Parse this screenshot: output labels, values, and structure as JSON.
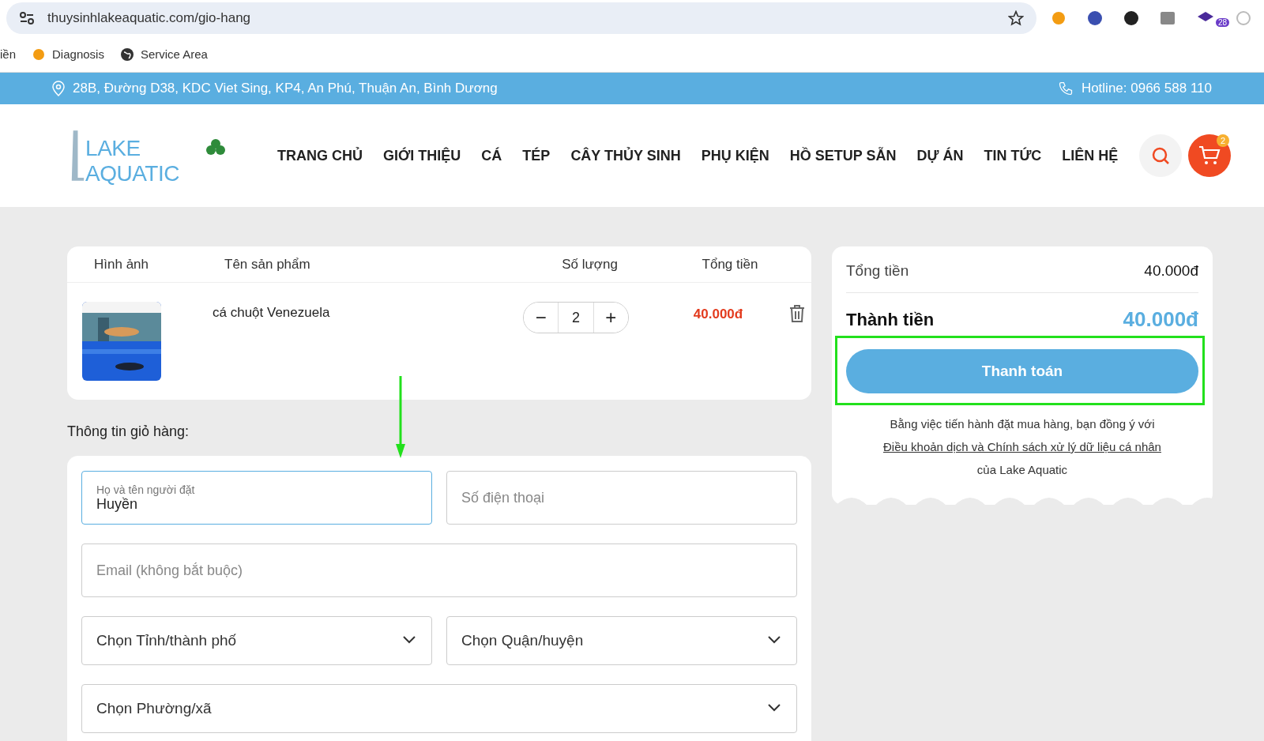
{
  "browser": {
    "url": "thuysinhlakeaquatic.com/gio-hang",
    "extension_badge": "28",
    "bookmarks": [
      "iền",
      "Diagnosis",
      "Service Area"
    ]
  },
  "topbar": {
    "address": "28B, Đường D38, KDC Viet Sing, KP4, An Phú, Thuận An, Bình Dương",
    "hotline": "Hotline: 0966 588 110"
  },
  "header": {
    "logo": "LAKE AQUATIC",
    "nav": [
      "TRANG CHỦ",
      "GIỚI THIỆU",
      "CÁ",
      "TÉP",
      "CÂY THỦY SINH",
      "PHỤ KIỆN",
      "HỒ SETUP SẴN",
      "DỰ ÁN",
      "TIN TỨC",
      "LIÊN HỆ"
    ],
    "cart_count": "2"
  },
  "cart": {
    "columns": [
      "Hình ảnh",
      "Tên sản phẩm",
      "Số lượng",
      "Tổng tiền"
    ],
    "rows": [
      {
        "name": "cá chuột Venezuela",
        "minus": "−",
        "quantity": "2",
        "plus": "+",
        "total": "40.000đ"
      }
    ]
  },
  "form": {
    "title": "Thông tin giỏ hàng:",
    "rows": [
      [
        {
          "kind": "text",
          "label": "Họ và tên người đặt",
          "value": "Huyền",
          "focused": true
        },
        {
          "kind": "text",
          "placeholder": "Số điện thoại",
          "focused": false
        }
      ],
      [
        {
          "kind": "text",
          "placeholder": "Email (không bắt buộc)",
          "focused": false
        }
      ],
      [
        {
          "kind": "select",
          "value": "Chọn Tỉnh/thành phố"
        },
        {
          "kind": "select",
          "value": "Chọn Quận/huyện"
        }
      ],
      [
        {
          "kind": "select",
          "value": "Chọn Phường/xã"
        }
      ]
    ]
  },
  "summary": {
    "subtotal_label": "Tổng tiền",
    "subtotal": "40.000đ",
    "total_label": "Thành tiền",
    "total": "40.000đ",
    "checkout": "Thanh toán",
    "note": "Bằng việc tiến hành đặt mua hàng, bạn đồng ý với",
    "terms_link": "Điều khoản dịch và Chính sách xử lý dữ liệu cá nhân",
    "note_end": "của Lake Aquatic"
  },
  "annotations": {
    "arrow": true,
    "highlight": true
  }
}
